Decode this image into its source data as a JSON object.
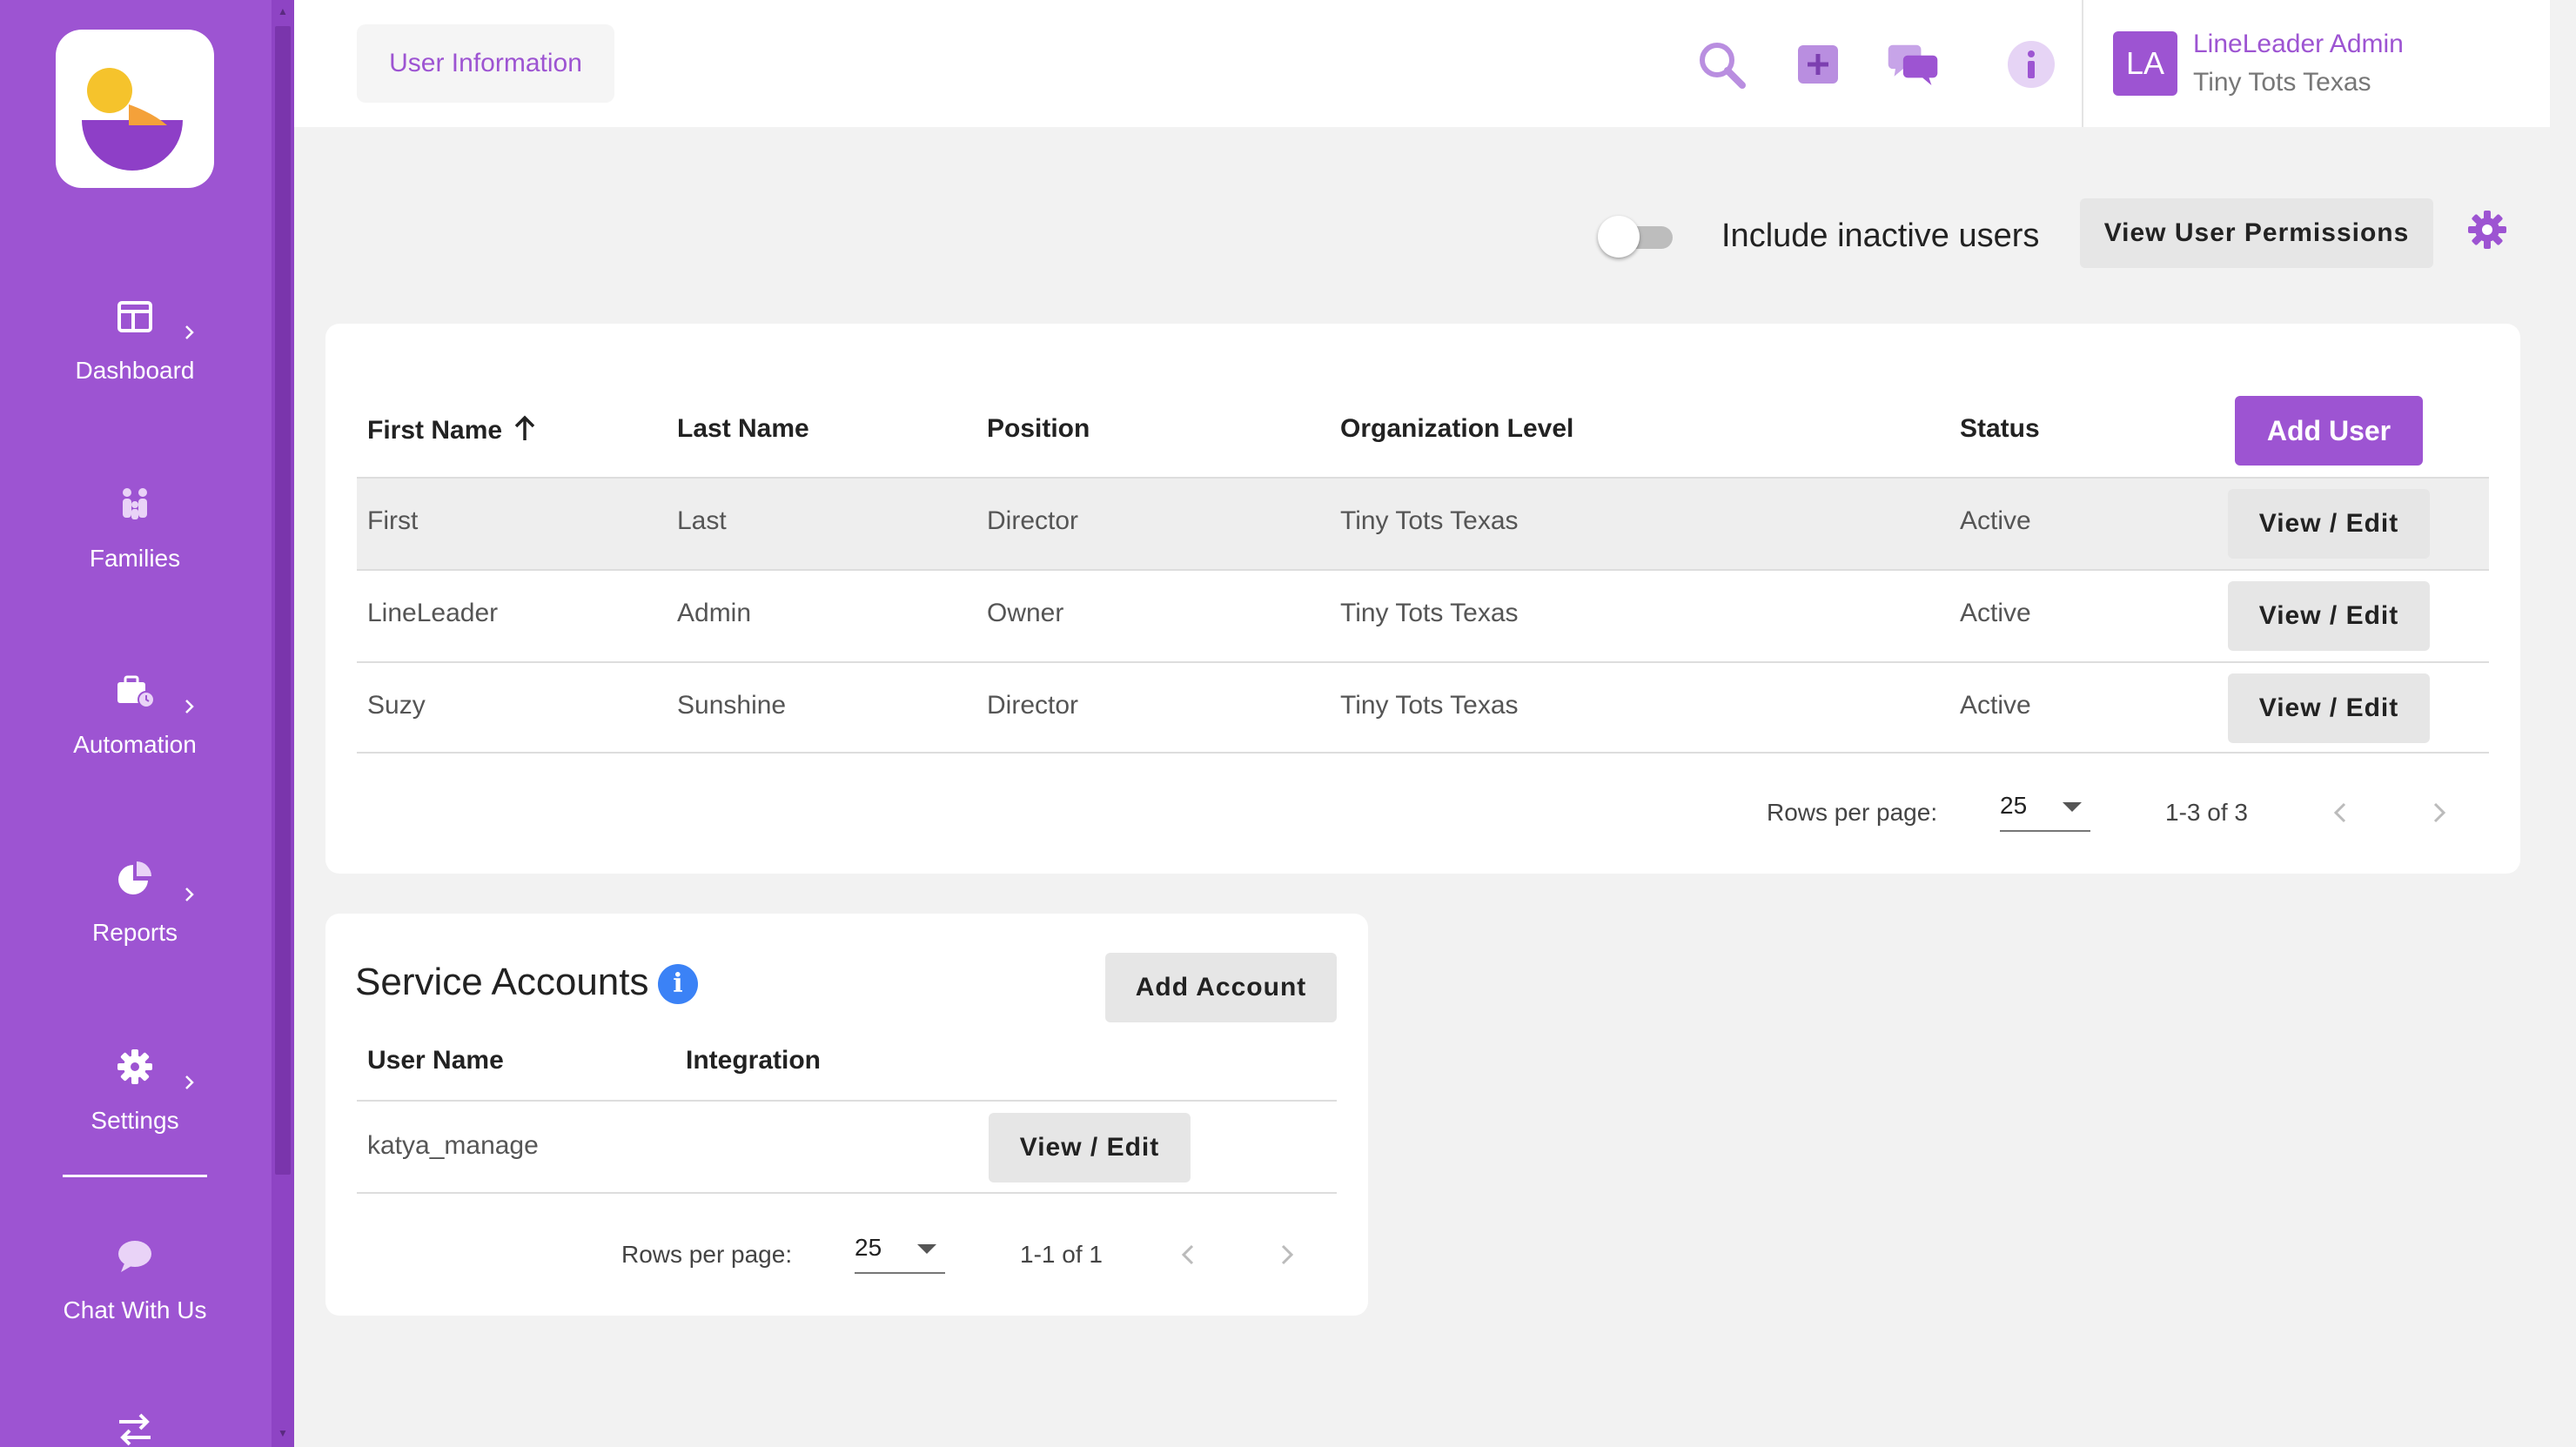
{
  "sidebar": {
    "nav": [
      {
        "label": "Dashboard",
        "icon": "dashboard-icon",
        "has_submenu": true
      },
      {
        "label": "Families",
        "icon": "families-icon",
        "has_submenu": false
      },
      {
        "label": "Automation",
        "icon": "automation-icon",
        "has_submenu": true
      },
      {
        "label": "Reports",
        "icon": "reports-icon",
        "has_submenu": true
      },
      {
        "label": "Settings",
        "icon": "settings-icon",
        "has_submenu": true
      },
      {
        "label": "Chat With Us",
        "icon": "chat-icon",
        "has_submenu": false
      }
    ]
  },
  "header": {
    "page_title": "User Information",
    "user": {
      "initials": "LA",
      "name": "LineLeader Admin",
      "org": "Tiny Tots Texas"
    }
  },
  "toolbar": {
    "inactive_label": "Include inactive users",
    "inactive_enabled": false,
    "permissions_label": "View User Permissions"
  },
  "users_table": {
    "columns": [
      "First Name",
      "Last Name",
      "Position",
      "Organization Level",
      "Status"
    ],
    "sort_column": "First Name",
    "sort_direction": "ascending",
    "add_label": "Add User",
    "rows": [
      {
        "first": "First",
        "last": "Last",
        "position": "Director",
        "org": "Tiny Tots Texas",
        "status": "Active",
        "action": "View / Edit"
      },
      {
        "first": "LineLeader",
        "last": "Admin",
        "position": "Owner",
        "org": "Tiny Tots Texas",
        "status": "Active",
        "action": "View / Edit"
      },
      {
        "first": "Suzy",
        "last": "Sunshine",
        "position": "Director",
        "org": "Tiny Tots Texas",
        "status": "Active",
        "action": "View / Edit"
      }
    ],
    "pager": {
      "rows_label": "Rows per page:",
      "rows_value": "25",
      "range": "1-3 of 3"
    }
  },
  "service_accounts": {
    "title": "Service Accounts",
    "add_label": "Add Account",
    "columns": [
      "User Name",
      "Integration"
    ],
    "rows": [
      {
        "user": "katya_manage",
        "integration": "",
        "action": "View / Edit"
      }
    ],
    "pager": {
      "rows_label": "Rows per page:",
      "rows_value": "25",
      "range": "1-1 of 1"
    }
  },
  "colors": {
    "brand": "#9d54d2",
    "info": "#3b82f6",
    "row_highlight": "#eeeeee"
  }
}
